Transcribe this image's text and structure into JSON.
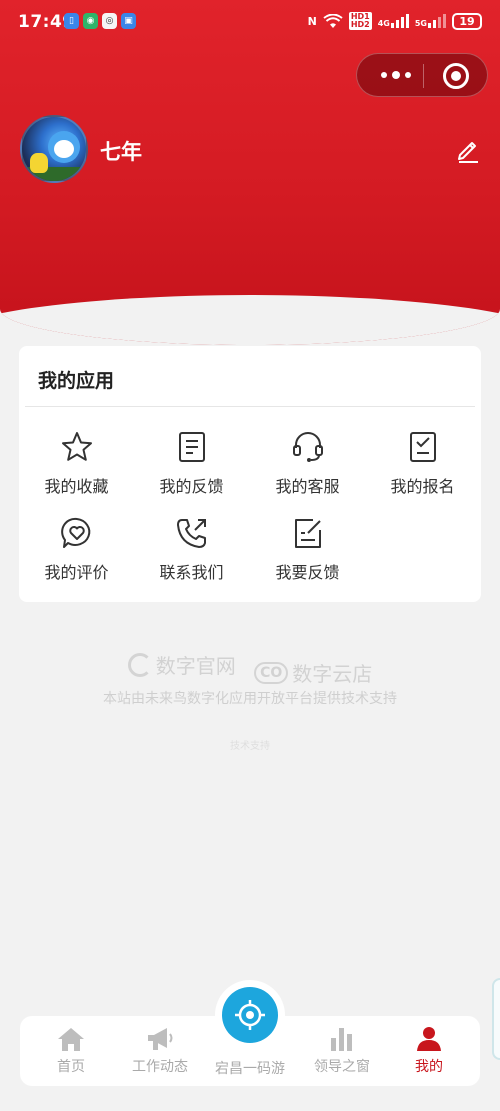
{
  "status_bar": {
    "time": "17:49",
    "network_4g": "4G",
    "network_5g": "5G",
    "hd1": "HD1",
    "hd2": "HD2",
    "battery": "19"
  },
  "profile": {
    "username": "七年"
  },
  "apps_card": {
    "title": "我的应用",
    "items": [
      {
        "label": "我的收藏",
        "icon": "star-icon"
      },
      {
        "label": "我的反馈",
        "icon": "document-icon"
      },
      {
        "label": "我的客服",
        "icon": "headset-icon"
      },
      {
        "label": "我的报名",
        "icon": "checklist-icon"
      },
      {
        "label": "我的评价",
        "icon": "heart-chat-icon"
      },
      {
        "label": "联系我们",
        "icon": "phone-icon"
      },
      {
        "label": "我要反馈",
        "icon": "edit-note-icon"
      }
    ]
  },
  "credit": {
    "logo1": "数字官网",
    "logo2": "数字云店",
    "text": "本站由未来鸟数字化应用开放平台提供技术支持",
    "tiny": "技术支持"
  },
  "tab_bar": {
    "tabs": [
      {
        "label": "首页",
        "icon": "home-icon"
      },
      {
        "label": "工作动态",
        "icon": "megaphone-icon"
      },
      {
        "label": "宕昌一码游",
        "icon": "locate-icon"
      },
      {
        "label": "领导之窗",
        "icon": "bar-chart-icon"
      },
      {
        "label": "我的",
        "icon": "person-icon"
      }
    ],
    "active_index": 4
  },
  "colors": {
    "brand_red": "#d41b23",
    "active_tab": "#c8161d",
    "center_button": "#1da6dd"
  }
}
